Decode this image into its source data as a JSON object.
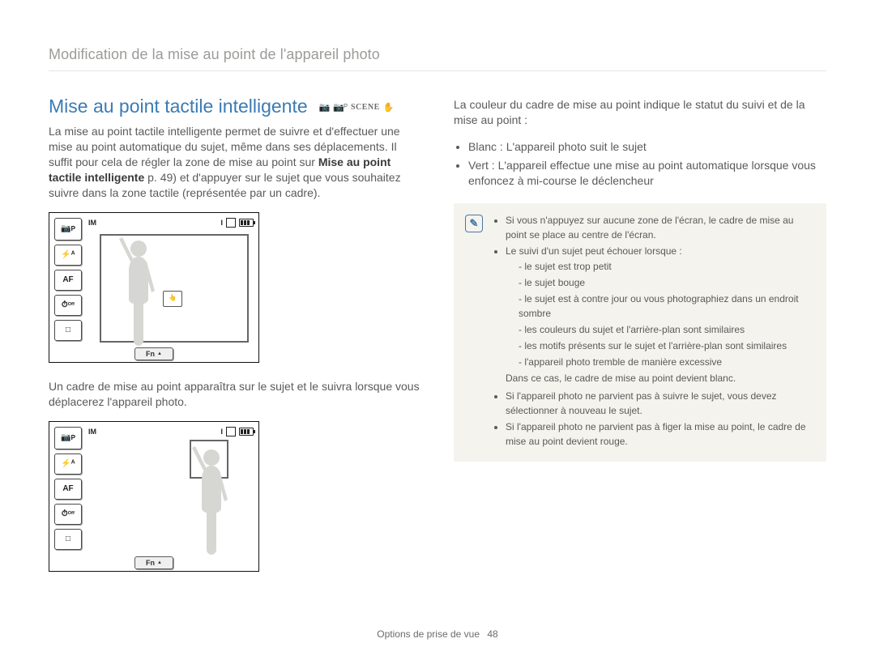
{
  "breadcrumb": "Modification de la mise au point de l'appareil photo",
  "section": {
    "title": "Mise au point tactile intelligente",
    "modes": [
      "cam-auto-icon",
      "cam-p-icon",
      "SCENE",
      "hand-icon"
    ],
    "intro_before_bold": "La mise au point tactile intelligente permet de suivre et d'effectuer une mise au point automatique du sujet, même dans ses déplacements. Il suffit pour cela de régler la zone de mise au point sur ",
    "intro_bold": "Mise au point tactile intelligente",
    "intro_after_bold": " p. 49) et d'appuyer sur le sujet que vous souhaitez suivre dans la zone tactile (représentée par un cadre)."
  },
  "camera": {
    "size_label": "IM",
    "shots": "I",
    "sidebar": {
      "mode": "P",
      "flash": "⚡ᴬ",
      "af": "AF",
      "timer": "ᴼᶠᶠ",
      "drive": "□"
    },
    "fn": "Fn",
    "focus_icon": "👆"
  },
  "caption_mid": "Un cadre de mise au point apparaîtra sur le sujet et le suivra lorsque vous déplacerez l'appareil photo.",
  "right": {
    "intro": "La couleur du cadre de mise au point indique le statut du suivi et de la mise au point :",
    "bullets": [
      "Blanc : L'appareil photo suit le sujet",
      "Vert : L'appareil effectue une mise au point automatique lorsque vous enfoncez à mi-course le déclencheur"
    ]
  },
  "note": {
    "items": [
      "Si vous n'appuyez sur aucune zone de l'écran, le cadre de mise au point se place au centre de l'écran.",
      "Le suivi d'un sujet peut échouer lorsque :"
    ],
    "sub": [
      "le sujet est trop petit",
      "le sujet bouge",
      "le sujet est à contre jour ou vous photographiez dans un endroit sombre",
      "les couleurs du sujet et l'arrière-plan sont similaires",
      "les motifs présents sur le sujet et l'arrière-plan sont similaires",
      "l'appareil photo tremble de manière excessive"
    ],
    "plain": "Dans ce cas, le cadre de mise au point devient blanc.",
    "tail": [
      "Si l'appareil photo ne parvient pas à suivre le sujet, vous devez sélectionner à nouveau le sujet.",
      "Si l'appareil photo ne parvient pas à figer la mise au point, le cadre de mise au point devient rouge."
    ]
  },
  "footer": {
    "chapter": "Options de prise de vue",
    "page": "48"
  }
}
